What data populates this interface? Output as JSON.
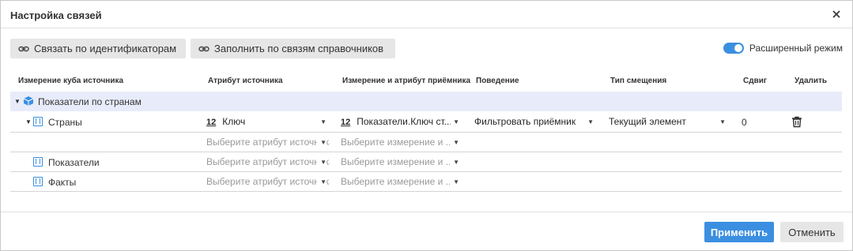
{
  "dialog": {
    "title": "Настройка связей",
    "icons": {
      "close": "close-icon",
      "link": "link-icon",
      "cube": "cube-icon",
      "dimension": "dimension-icon",
      "delete": "trash-icon"
    },
    "accent_color": "#3b8fe0"
  },
  "toolbar": {
    "link_by_ids_label": "Связать по идентификаторам",
    "fill_by_dict_label": "Заполнить по связям справочников",
    "advanced_mode_label": "Расширенный режим",
    "advanced_mode_on": true
  },
  "columns": {
    "source_dimension": "Измерение куба источника",
    "source_attribute": "Атрибут источника",
    "target_dim_attr": "Измерение и атрибут приёмника",
    "behavior": "Поведение",
    "offset_type": "Тип смещения",
    "offset": "Сдвиг",
    "delete": "Удалить"
  },
  "group": {
    "label": "Показатели по странам"
  },
  "rows": {
    "countries": {
      "label": "Страны",
      "source_attr_number": "12",
      "source_attr": "Ключ",
      "target_number": "12",
      "target": "Показатели.Ключ ст...",
      "behavior": "Фильтровать приёмник",
      "offset_type": "Текущий элемент",
      "offset": "0"
    },
    "countries_extra": {
      "source_attr_placeholder": "Выберите атрибут источника",
      "target_placeholder": "Выберите измерение и ..."
    },
    "indicators": {
      "label": "Показатели",
      "source_attr_placeholder": "Выберите атрибут источника",
      "target_placeholder": "Выберите измерение и ..."
    },
    "facts": {
      "label": "Факты",
      "source_attr_placeholder": "Выберите атрибут источника",
      "target_placeholder": "Выберите измерение и ..."
    }
  },
  "footer": {
    "apply_label": "Применить",
    "cancel_label": "Отменить"
  }
}
